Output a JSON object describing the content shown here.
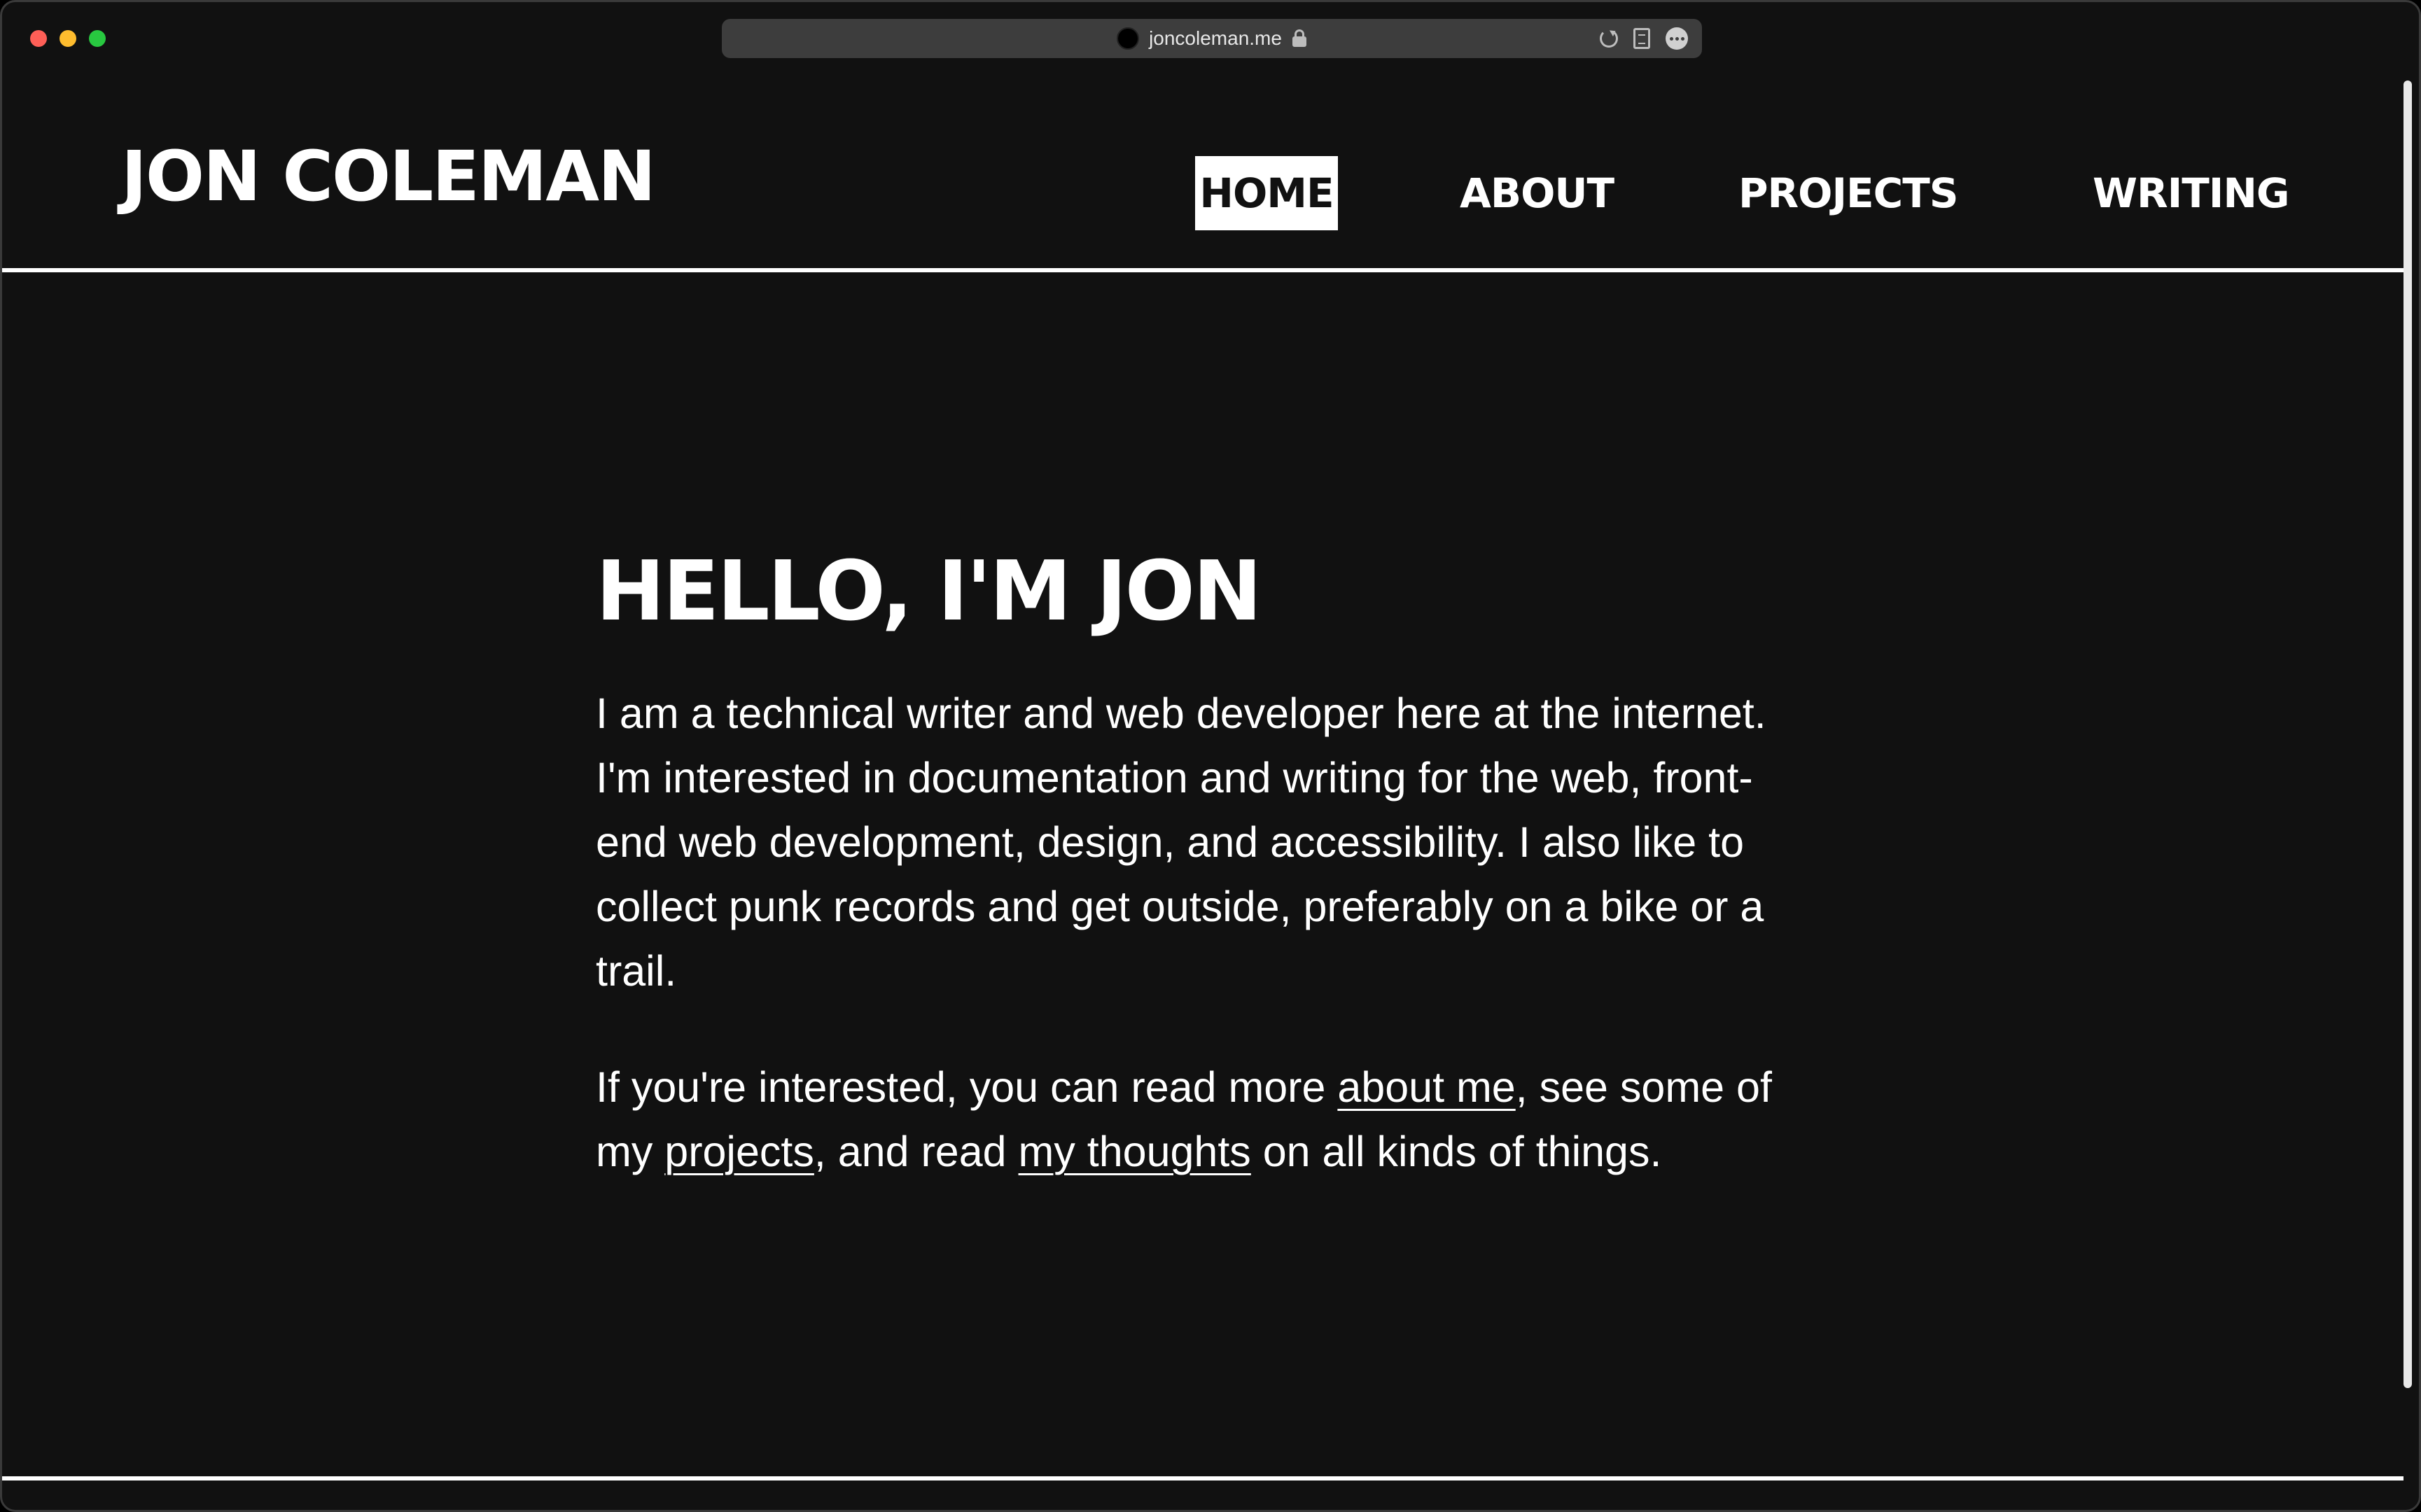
{
  "browser": {
    "url": "joncoleman.me"
  },
  "site": {
    "title": "JON COLEMAN",
    "nav": {
      "home": "HOME",
      "about": "ABOUT",
      "projects": "PROJECTS",
      "writing": "WRITING"
    },
    "active_nav": "HOME"
  },
  "main": {
    "heading": "HELLO, I'M JON",
    "intro": "I am a technical writer and web developer here at the internet. I'm interested in documentation and writing for the web, front-end web development, design, and accessibility. I also like to collect punk records and get outside, preferably on a bike or a trail.",
    "cta": {
      "before_about": "If you're interested, you can read more ",
      "about_link": "about me",
      "before_projects": ", see some of my ",
      "projects_link": "projects",
      "before_thoughts": ", and read ",
      "thoughts_link": "my thoughts",
      "after_thoughts": " on all kinds of things."
    }
  },
  "colors": {
    "background": "#111111",
    "foreground": "#ffffff"
  }
}
